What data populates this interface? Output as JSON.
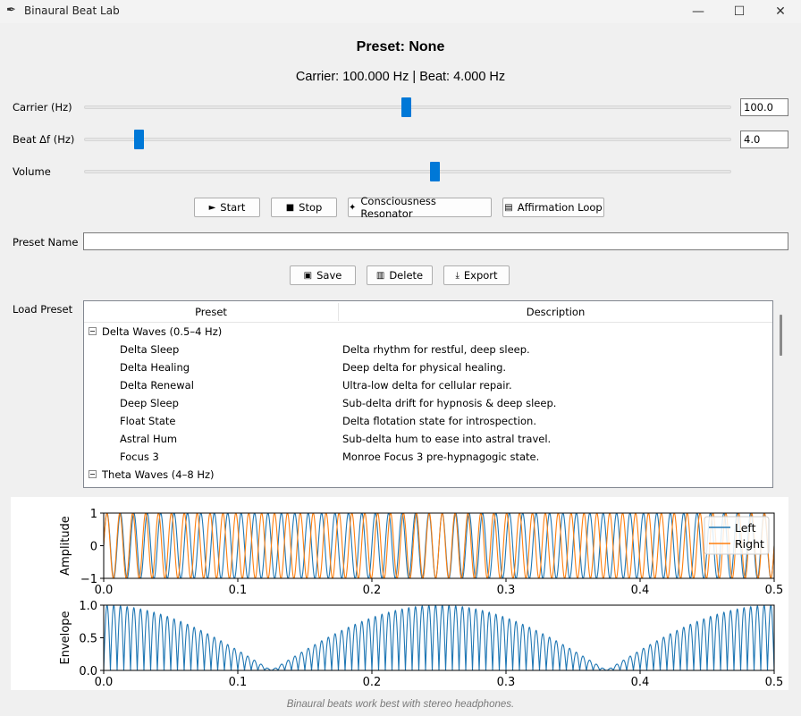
{
  "window": {
    "title": "Binaural Beat Lab",
    "icon": "feather-icon"
  },
  "header": {
    "preset_title": "Preset: None",
    "freq_readout": "Carrier: 100.000 Hz | Beat: 4.000 Hz"
  },
  "sliders": {
    "carrier": {
      "label": "Carrier (Hz)",
      "value": "100.0",
      "fraction": 0.486
    },
    "beat": {
      "label": "Beat Δf (Hz)",
      "value": "4.0",
      "fraction": 0.083
    },
    "volume": {
      "label": "Volume",
      "fraction": 0.541
    }
  },
  "controls": {
    "start": {
      "label": "Start",
      "icon": "play-icon"
    },
    "stop": {
      "label": "Stop",
      "icon": "stop-icon"
    },
    "resonator": {
      "label": "Consciousness Resonator",
      "icon": "sparkle-icon"
    },
    "affirmation": {
      "label": "Affirmation Loop",
      "icon": "notepad-icon"
    }
  },
  "preset_name": {
    "label": "Preset Name",
    "value": ""
  },
  "preset_actions": {
    "save": {
      "label": "Save",
      "icon": "floppy-icon"
    },
    "delete": {
      "label": "Delete",
      "icon": "trash-icon"
    },
    "export": {
      "label": "Export",
      "icon": "export-icon"
    }
  },
  "load_preset": {
    "label": "Load Preset",
    "columns": [
      "Preset",
      "Description"
    ],
    "groups": [
      {
        "name": "Delta Waves (0.5–4 Hz)",
        "expanded": true,
        "items": [
          {
            "name": "Delta Sleep",
            "description": "Delta rhythm for restful, deep sleep."
          },
          {
            "name": "Delta Healing",
            "description": "Deep delta for physical healing."
          },
          {
            "name": "Delta Renewal",
            "description": "Ultra-low delta for cellular repair."
          },
          {
            "name": "Deep Sleep",
            "description": "Sub-delta drift for hypnosis & deep sleep."
          },
          {
            "name": "Float State",
            "description": "Delta flotation state for introspection."
          },
          {
            "name": "Astral Hum",
            "description": "Sub-delta hum to ease into astral travel."
          },
          {
            "name": "Focus 3",
            "description": "Monroe Focus 3 pre-hypnagogic state."
          }
        ]
      },
      {
        "name": "Theta Waves (4–8 Hz)",
        "expanded": true,
        "items": []
      }
    ]
  },
  "chart_data": [
    {
      "type": "line",
      "title": "",
      "xlabel": "",
      "ylabel": "Amplitude",
      "xlim": [
        0.0,
        0.5
      ],
      "ylim": [
        -1,
        1
      ],
      "xticks": [
        "0.0",
        "0.1",
        "0.2",
        "0.3",
        "0.4",
        "0.5"
      ],
      "yticks": [
        "1",
        "0",
        "−1"
      ],
      "legend": "upper-right",
      "series": [
        {
          "name": "Left",
          "function": "sin(2π·100·t)",
          "frequency_hz": 100,
          "color": "#1f77b4"
        },
        {
          "name": "Right",
          "function": "sin(2π·104·t)",
          "frequency_hz": 104,
          "color": "#ff7f0e"
        }
      ]
    },
    {
      "type": "line",
      "title": "",
      "xlabel": "",
      "ylabel": "Envelope",
      "xlim": [
        0.0,
        0.5
      ],
      "ylim": [
        0.0,
        1.0
      ],
      "xticks": [
        "0.0",
        "0.1",
        "0.2",
        "0.3",
        "0.4",
        "0.5"
      ],
      "yticks": [
        "1.0",
        "0.5",
        "0.0"
      ],
      "series": [
        {
          "function": "|sin(2π·100·t)·|cos(2π·2·t)||",
          "color": "#1f77b4"
        }
      ]
    }
  ],
  "footer": {
    "note": "Binaural beats work best with stereo headphones."
  },
  "colors": {
    "accent": "#0078d7",
    "left": "#1f77b4",
    "right": "#ff7f0e"
  }
}
